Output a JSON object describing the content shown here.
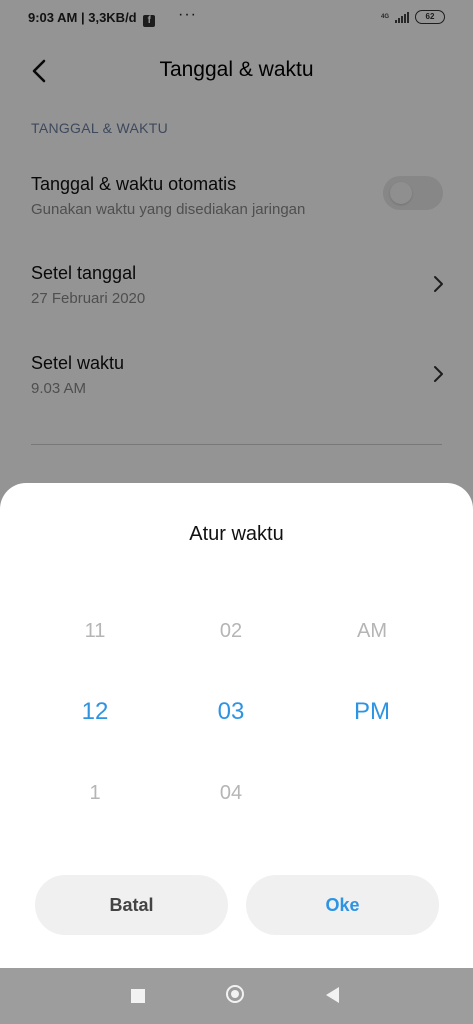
{
  "status_bar": {
    "time_speed": "9:03 AM | 3,3KB/d",
    "fb_icon": "f",
    "more": "···",
    "network_type": "4G",
    "battery": "62"
  },
  "header": {
    "title": "Tanggal & waktu"
  },
  "settings": {
    "section_label": "TANGGAL & WAKTU",
    "auto_title": "Tanggal & waktu otomatis",
    "auto_subtitle": "Gunakan waktu yang disediakan jaringan",
    "auto_enabled": false,
    "date_title": "Setel tanggal",
    "date_value": "27 Februari 2020",
    "time_title": "Setel waktu",
    "time_value": "9.03 AM"
  },
  "dialog": {
    "title": "Atur waktu",
    "hours": {
      "prev": "11",
      "selected": "12",
      "next": "1"
    },
    "minutes": {
      "prev": "02",
      "selected": "03",
      "next": "04"
    },
    "ampm": {
      "prev": "AM",
      "selected": "PM",
      "next": ""
    },
    "cancel_label": "Batal",
    "ok_label": "Oke",
    "accent_color": "#2d94e4"
  },
  "nav": {
    "icons": [
      "recents-icon",
      "home-icon",
      "back-icon"
    ]
  }
}
